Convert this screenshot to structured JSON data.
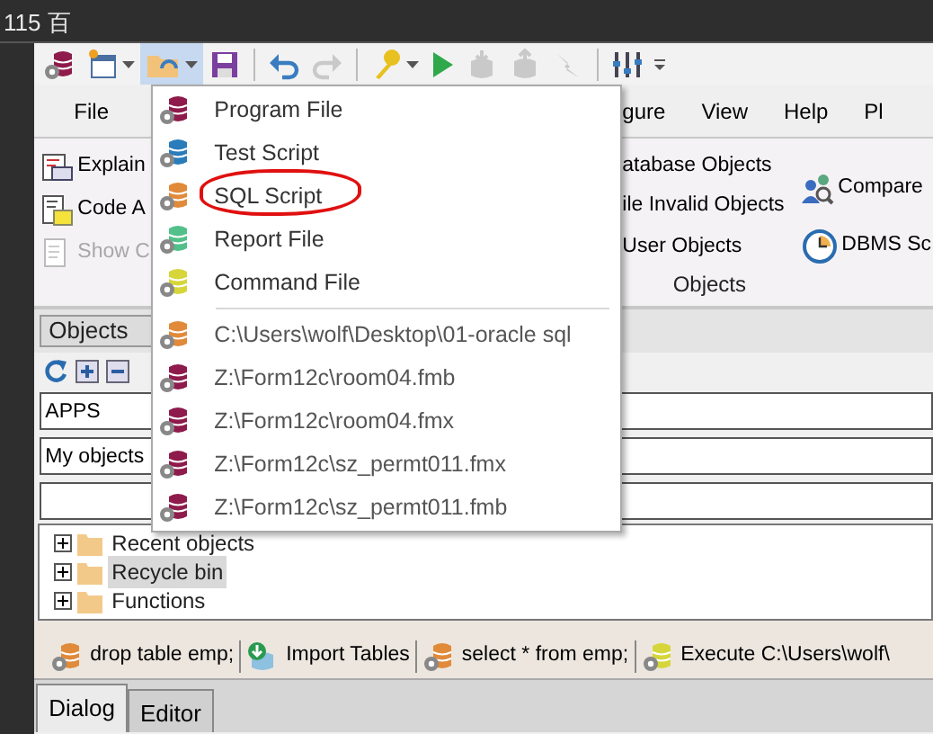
{
  "corner_text": "115 百",
  "toolbar": [
    {
      "kind": "app",
      "dropdown": false,
      "pressed": false,
      "disabled": false
    },
    {
      "kind": "new",
      "dropdown": true,
      "pressed": false,
      "disabled": false
    },
    {
      "kind": "open",
      "dropdown": true,
      "pressed": true,
      "disabled": false
    },
    {
      "kind": "save",
      "dropdown": false,
      "pressed": false,
      "disabled": false
    },
    {
      "kind": "separator"
    },
    {
      "kind": "undo",
      "dropdown": false,
      "pressed": false,
      "disabled": false
    },
    {
      "kind": "redo",
      "dropdown": false,
      "pressed": false,
      "disabled": true
    },
    {
      "kind": "separator"
    },
    {
      "kind": "key",
      "dropdown": true,
      "pressed": false,
      "disabled": false
    },
    {
      "kind": "run",
      "dropdown": false,
      "pressed": false,
      "disabled": false
    },
    {
      "kind": "db-down",
      "dropdown": false,
      "pressed": false,
      "disabled": true
    },
    {
      "kind": "db-up",
      "dropdown": false,
      "pressed": false,
      "disabled": true
    },
    {
      "kind": "break",
      "dropdown": false,
      "pressed": false,
      "disabled": true
    },
    {
      "kind": "separator"
    },
    {
      "kind": "columns",
      "dropdown": false,
      "pressed": false,
      "disabled": false
    },
    {
      "kind": "overflow",
      "dropdown": false,
      "pressed": false,
      "disabled": false
    }
  ],
  "ribbon_tabs_left": [
    "File"
  ],
  "ribbon_tabs_right": [
    "gure",
    "View",
    "Help",
    "Pl"
  ],
  "ribbon": {
    "left_items": [
      {
        "label": "Explain",
        "kind": "explain",
        "disabled": false
      },
      {
        "label": "Code A",
        "kind": "code",
        "disabled": false
      },
      {
        "label": "Show C",
        "kind": "show",
        "disabled": true
      }
    ],
    "middle_items": [
      "atabase Objects",
      "ile Invalid Objects",
      "User Objects"
    ],
    "middle_group_label": "Objects",
    "right_items": [
      {
        "label": "Compare",
        "kind": "compare"
      },
      {
        "label": "DBMS Sc",
        "kind": "clock"
      }
    ]
  },
  "objects_panel": {
    "header": "Objects",
    "owner": "APPS",
    "filter": "My objects",
    "tree": [
      {
        "label": "Recent objects",
        "expanded": false,
        "selected": false
      },
      {
        "label": "Recycle bin",
        "expanded": false,
        "selected": true
      },
      {
        "label": "Functions",
        "expanded": false,
        "selected": false
      }
    ]
  },
  "bottom_toolbar": [
    {
      "label": "drop table emp;",
      "kind": "script",
      "color": "#e08a3a"
    },
    {
      "label": "Import Tables",
      "kind": "import"
    },
    {
      "label": "select * from emp;",
      "kind": "script",
      "color": "#e08a3a"
    },
    {
      "label": "Execute C:\\Users\\wolf\\",
      "kind": "script",
      "color": "#d6d63a"
    }
  ],
  "bottom_tabs": [
    {
      "label": "Dialog",
      "selected": true
    },
    {
      "label": "Editor",
      "selected": false
    }
  ],
  "open_menu": {
    "items": [
      {
        "label": "Program File",
        "color": "#8e1b4b",
        "highlighted": false
      },
      {
        "label": "Test Script",
        "color": "#2a7cba",
        "highlighted": false
      },
      {
        "label": "SQL Script",
        "color": "#e08a3a",
        "highlighted": true
      },
      {
        "label": "Report File",
        "color": "#52c08a",
        "highlighted": false
      },
      {
        "label": "Command File",
        "color": "#d6d63a",
        "highlighted": false
      }
    ],
    "recent": [
      {
        "label": "C:\\Users\\wolf\\Desktop\\01-oracle sql",
        "color": "#e08a3a"
      },
      {
        "label": "Z:\\Form12c\\room04.fmb",
        "color": "#8e1b4b"
      },
      {
        "label": "Z:\\Form12c\\room04.fmx",
        "color": "#8e1b4b"
      },
      {
        "label": "Z:\\Form12c\\sz_permt011.fmx",
        "color": "#8e1b4b"
      },
      {
        "label": "Z:\\Form12c\\sz_permt011.fmb",
        "color": "#8e1b4b"
      }
    ]
  }
}
